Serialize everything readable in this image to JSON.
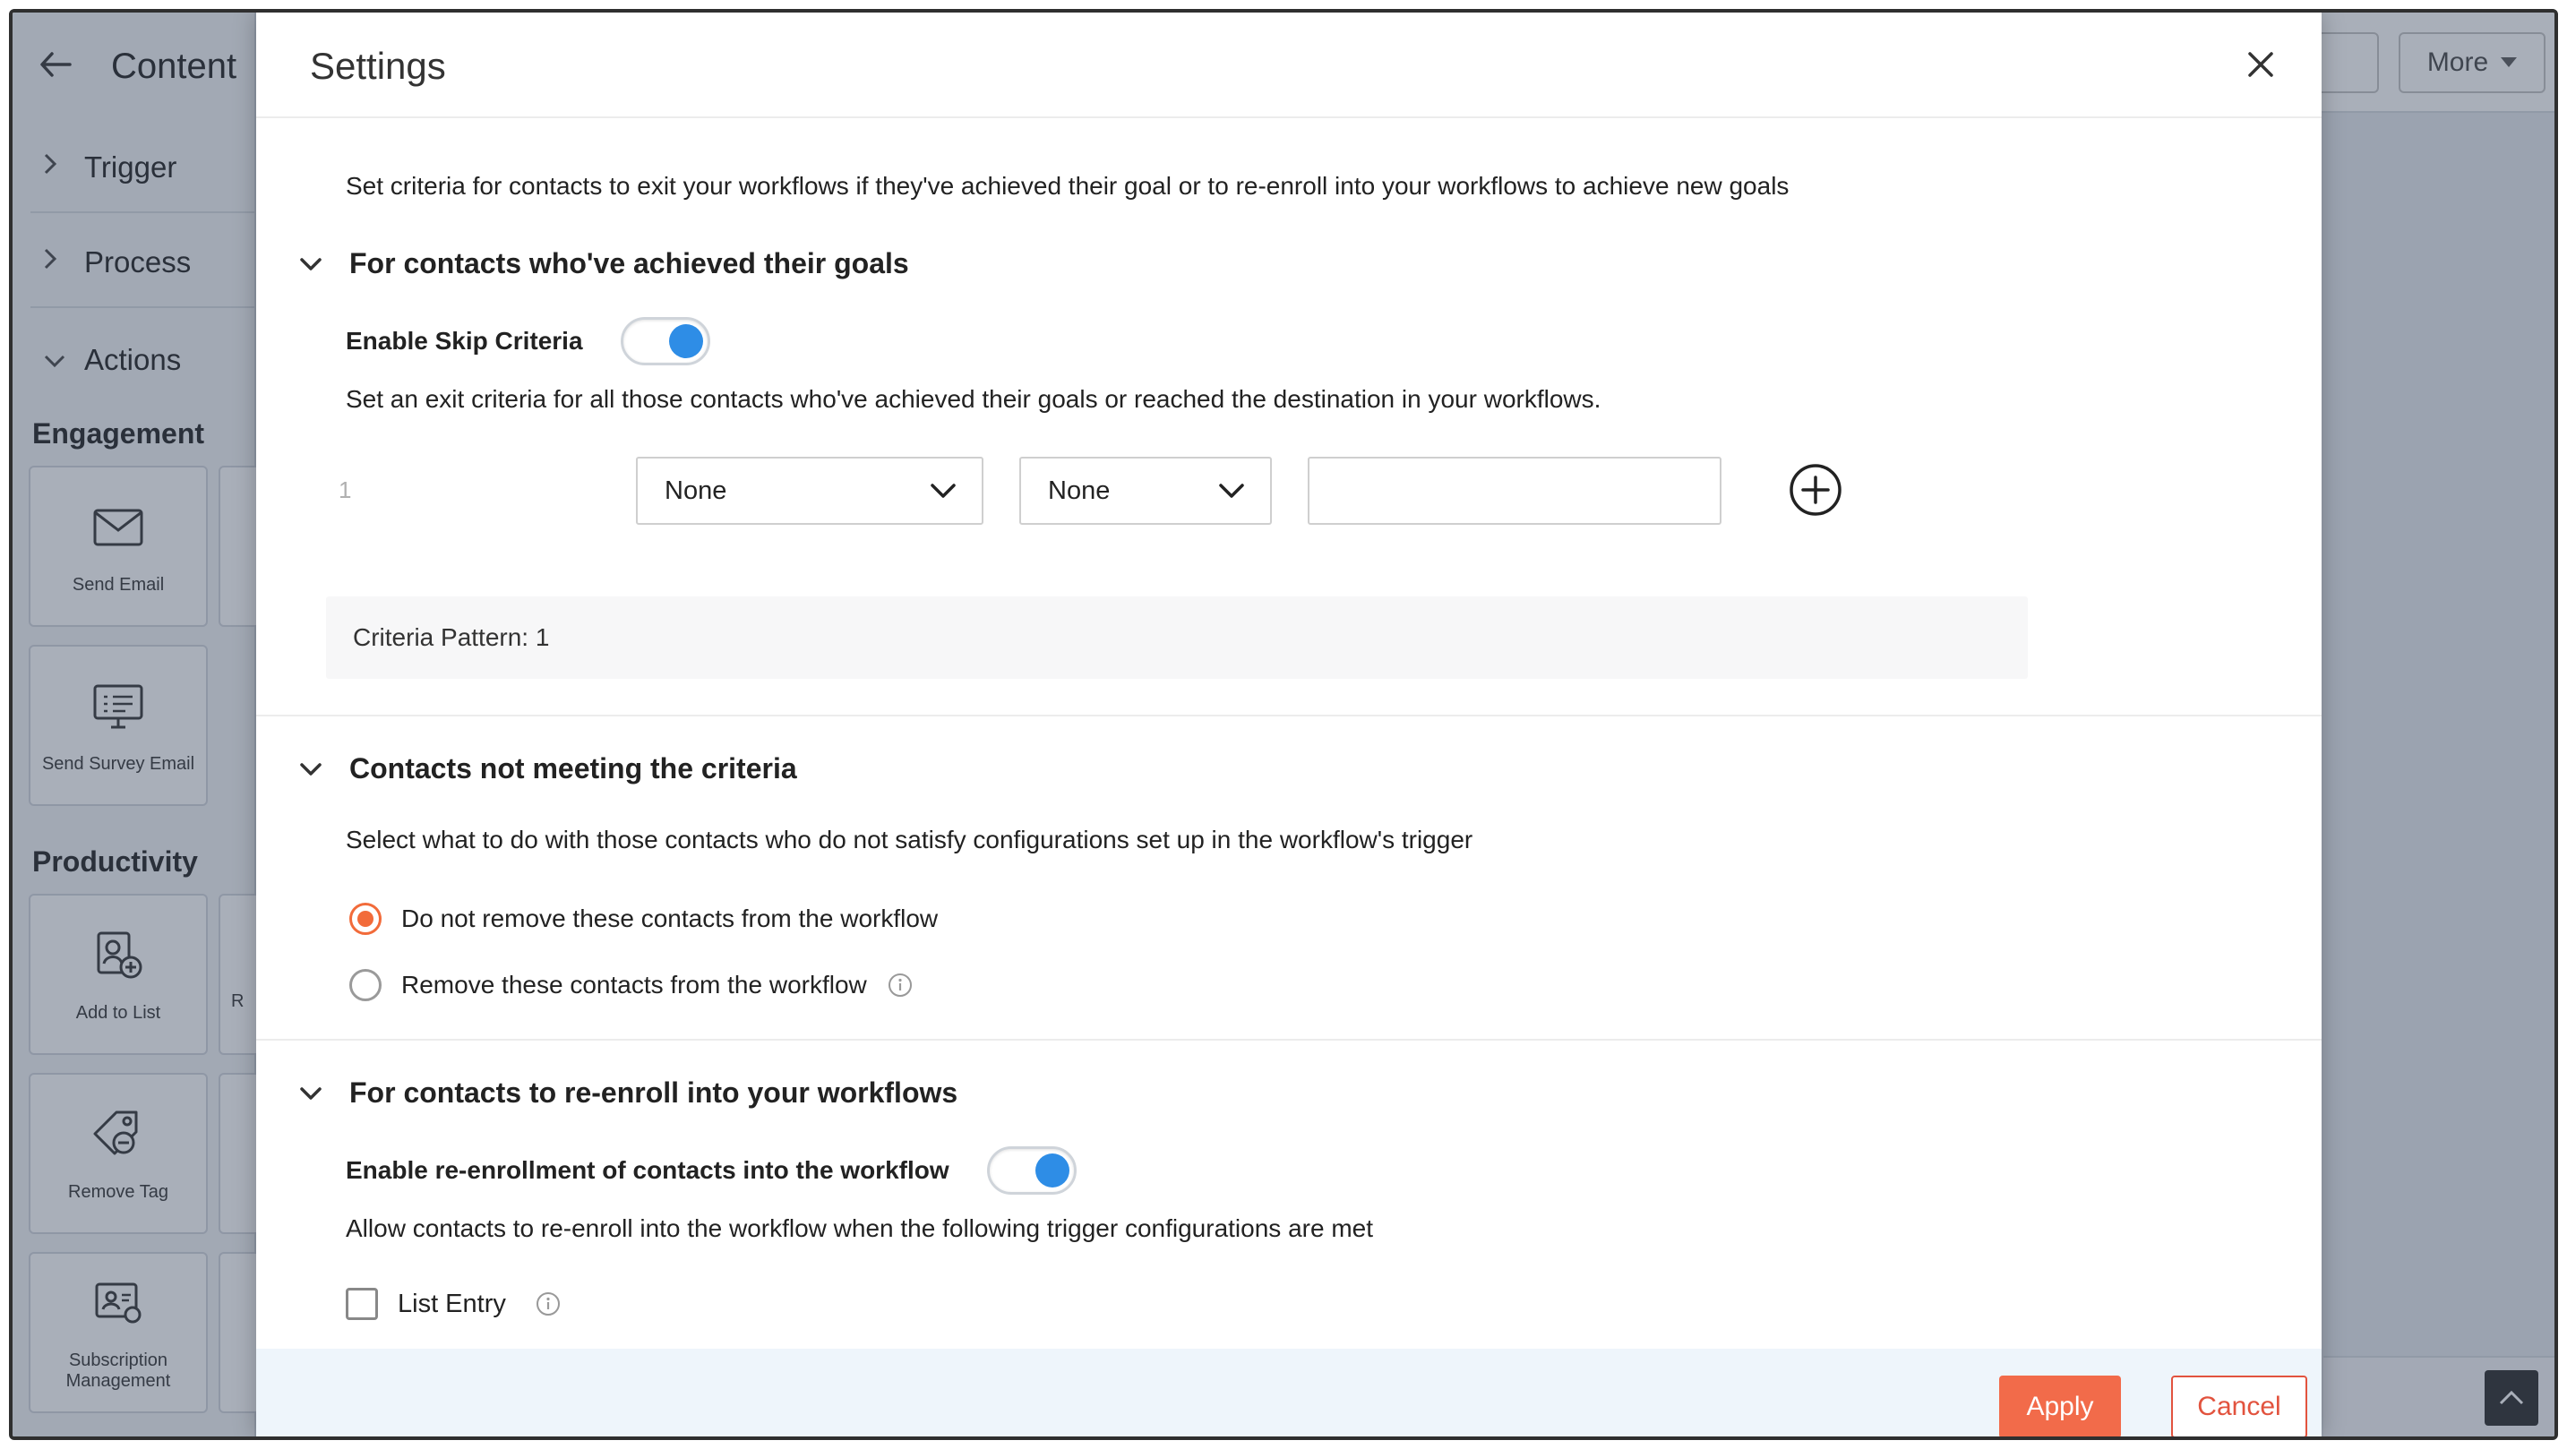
{
  "background": {
    "title": "Content",
    "top_right_button": "More",
    "sidebar_sections": [
      {
        "label": "Trigger"
      },
      {
        "label": "Process"
      },
      {
        "label": "Actions"
      }
    ],
    "categories": [
      "Engagement",
      "Productivity"
    ],
    "tiles": [
      {
        "label": "Send Email",
        "icon": "envelope-icon"
      },
      {
        "label": "Send Survey Email",
        "icon": "survey-monitor-icon"
      },
      {
        "label": "Add to List",
        "icon": "add-to-list-icon"
      },
      {
        "label": "Remove Tag",
        "icon": "remove-tag-icon"
      },
      {
        "label": "Subscription Management",
        "icon": "subscription-icon"
      }
    ],
    "partial_tile_letter": "R"
  },
  "modal": {
    "title": "Settings",
    "intro": "Set criteria for contacts to exit your workflows if they've achieved their goal or to re-enroll into your workflows to achieve new goals",
    "goals_section": {
      "heading": "For contacts who've achieved their goals",
      "toggle_label": "Enable Skip Criteria",
      "toggle_on": true,
      "description": "Set an exit criteria for all those contacts who've achieved their goals or reached the destination in your workflows.",
      "row_number": "1",
      "field_select": "None",
      "operator_select": "None",
      "value": "",
      "pattern_label": "Criteria Pattern: 1"
    },
    "criteria_section": {
      "heading": "Contacts not meeting the criteria",
      "description": "Select what to do with those contacts who do not satisfy configurations set up in the workflow's trigger",
      "options": [
        {
          "label": "Do not remove these contacts from the workflow",
          "checked": true
        },
        {
          "label": "Remove these contacts from the workflow",
          "checked": false
        }
      ]
    },
    "reenroll_section": {
      "heading": "For contacts to re-enroll into your workflows",
      "toggle_label": "Enable re-enrollment of contacts into the workflow",
      "toggle_on": true,
      "description": "Allow contacts to re-enroll into the workflow when the following trigger configurations are met",
      "checkbox_label": "List Entry",
      "checkbox_checked": false
    },
    "footer": {
      "apply_label": "Apply",
      "cancel_label": "Cancel"
    }
  },
  "colors": {
    "accent": "#f26b4a",
    "toggle_on": "#2e8de6",
    "radio_selected": "#f26b3a"
  }
}
